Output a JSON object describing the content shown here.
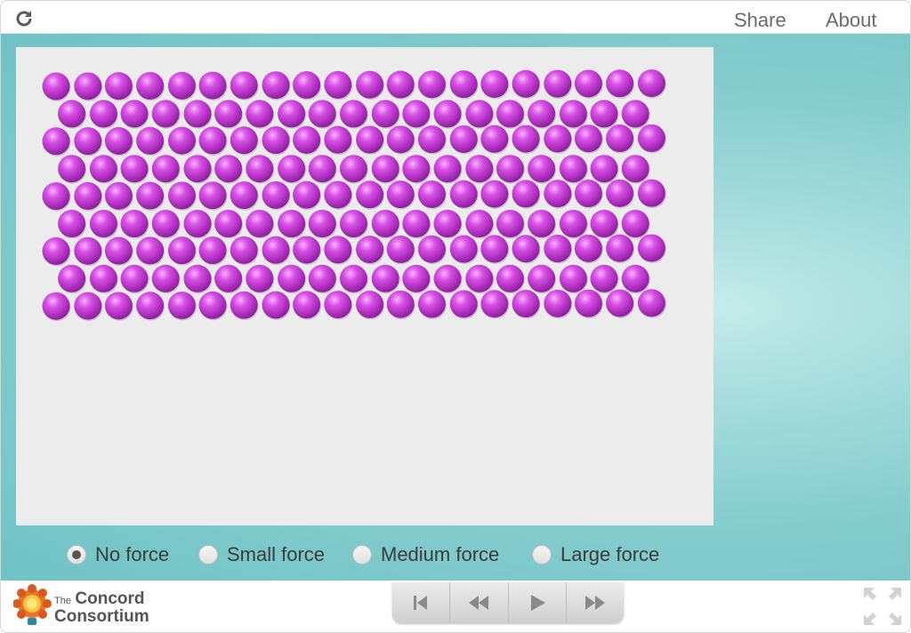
{
  "header": {
    "share_label": "Share",
    "about_label": "About",
    "reload_icon": "reload-icon"
  },
  "model": {
    "particle_color": "#b52bc8",
    "particle_highlight": "#f08cf8",
    "background_color": "#ececec",
    "rows": [
      20,
      19,
      20,
      19,
      20,
      19,
      20,
      19,
      20
    ]
  },
  "force_options": {
    "selected": "No force",
    "items": [
      {
        "label": "No force",
        "checked": true
      },
      {
        "label": "Small force",
        "checked": false
      },
      {
        "label": "Medium force",
        "checked": false
      },
      {
        "label": "Large force",
        "checked": false
      }
    ]
  },
  "footer": {
    "logo_small": "The",
    "logo_line1": "Concord",
    "logo_line2": "Consortium",
    "playback_buttons": [
      "reset-icon",
      "step-back-icon",
      "play-icon",
      "step-forward-icon"
    ],
    "fullscreen_icon": "fullscreen-icon"
  },
  "colors": {
    "accent": "#86cdcd",
    "text": "#3c3c3c"
  }
}
